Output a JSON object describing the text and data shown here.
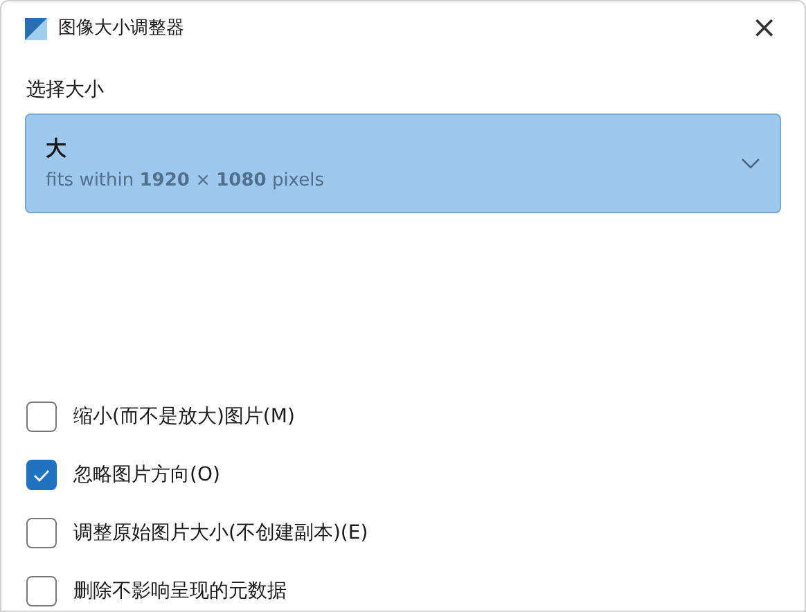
{
  "window": {
    "title": "图像大小调整器",
    "close": "×"
  },
  "size_select": {
    "label": "选择大小",
    "value": "大",
    "description": "fits within **1920** × **1080** pixels"
  },
  "options": [
    {
      "label": "缩小(而不是放大)图片(M)",
      "checked": false
    },
    {
      "label": "忽略图片方向(O)",
      "checked": true
    },
    {
      "label": "调整原始图片大小(不创建副本)(E)",
      "checked": false
    },
    {
      "label": "删除不影响呈现的元数据",
      "checked": false
    }
  ]
}
